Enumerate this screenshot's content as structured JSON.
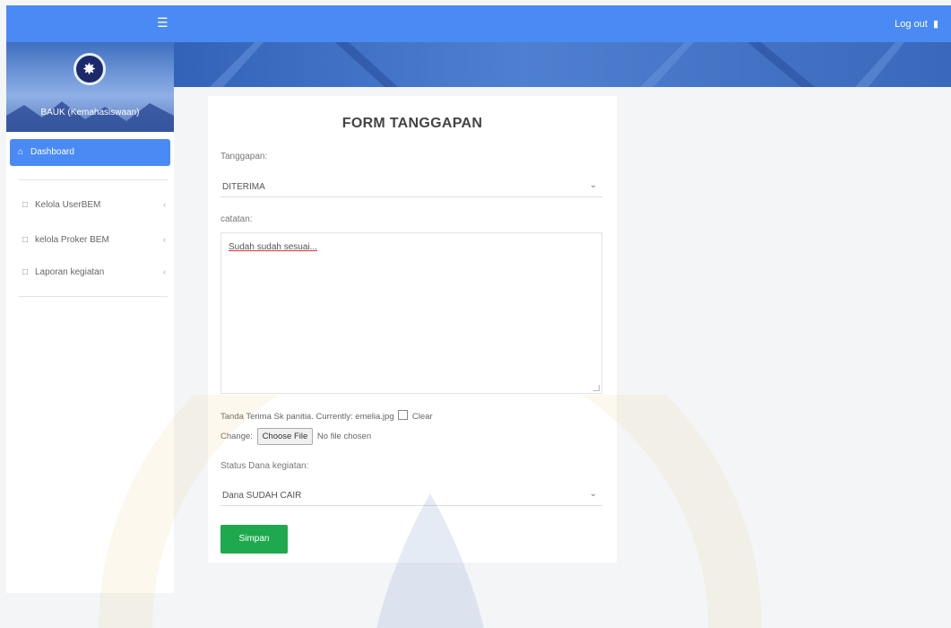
{
  "topbar": {
    "menu_icon": "hamburger-icon",
    "logout_label": "Log out",
    "logout_icon": "logout-icon",
    "bg_color": "#4a8af4"
  },
  "sidebar": {
    "logo_icon": "organization-logo",
    "title": "BAUK (Kemahasiswaan)",
    "active_item": {
      "icon": "home-icon",
      "label": "Dashboard"
    },
    "items": [
      {
        "icon": "folder-icon",
        "label": "Kelola UserBEM"
      },
      {
        "icon": "folder-icon",
        "label": "kelola Proker BEM"
      },
      {
        "icon": "folder-icon",
        "label": "Laporan kegiatan"
      }
    ]
  },
  "form": {
    "title": "FORM TANGGAPAN",
    "tanggapan_label": "Tanggapan:",
    "tanggapan_value": "DITERIMA",
    "catatan_label": "catatan:",
    "catatan_value": "Sudah sudah sesuai...",
    "file_text": "Tanda Terima Sk panitia. Currently: emelia.jpg",
    "clear_label": "Clear",
    "change_label": "Change:",
    "choose_file_label": "Choose File",
    "no_file_text": "No file chosen",
    "status_label": "Status Dana kegiatan:",
    "status_value": "Dana SUDAH CAIR",
    "save_label": "Simpan",
    "save_color": "#1fa94f"
  }
}
